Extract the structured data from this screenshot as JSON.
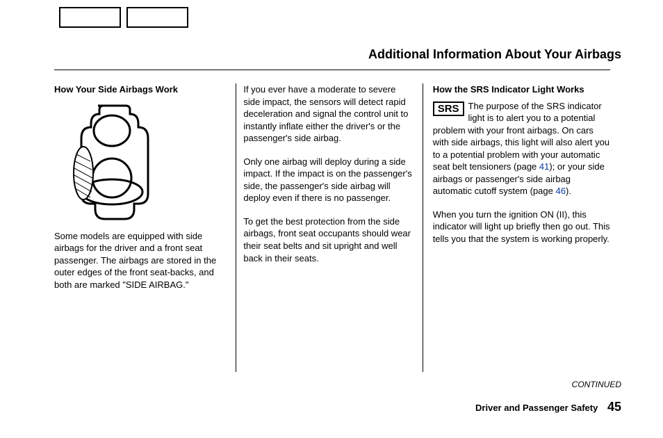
{
  "title": "Additional Information About Your Airbags",
  "col1": {
    "heading": "How Your Side Airbags Work",
    "para1": "Some models are equipped with side airbags for the driver and a front seat passenger. The airbags are stored in the outer edges of the front seat-backs, and both are marked \"SIDE AIRBAG.\""
  },
  "col2": {
    "para1": "If you ever have a moderate to severe side impact, the sensors will detect rapid deceleration and signal the control unit to instantly inflate either the driver's or the passenger's side airbag.",
    "para2": "Only one airbag will deploy during a side impact. If the impact is on the passenger's side, the passenger's side airbag will deploy even if there is no passenger.",
    "para3": "To get the best protection from the side airbags, front seat occupants should wear their seat belts and sit upright and well back in their seats."
  },
  "col3": {
    "heading": "How the SRS Indicator Light Works",
    "srs_label": "SRS",
    "para1a": "The purpose of the SRS indicator light is to alert ",
    "para1b": "you to a potential problem with your front airbags. On cars with side airbags, this light will also alert you to a potential problem with your automatic seat belt tensioners (page ",
    "link41": "41",
    "para1c": "); or your side airbags or passenger's side airbag automatic cutoff system (page ",
    "link46": "46",
    "para1d": ").",
    "para2": "When you turn the ignition ON (II), this indicator will light up briefly then go out. This tells you that the system is working properly."
  },
  "continued": "CONTINUED",
  "footer_label": "Driver and Passenger Safety",
  "page_number": "45"
}
